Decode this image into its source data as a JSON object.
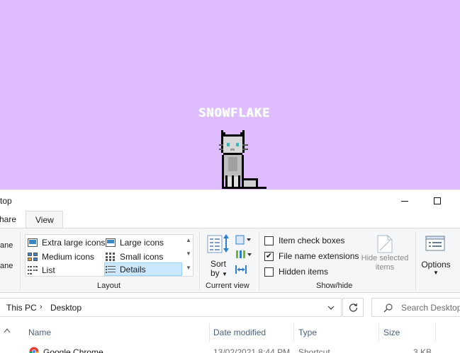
{
  "wallpaper": {
    "title": "SNOWFLAKE",
    "background": "#dfbcfd"
  },
  "window": {
    "title": "top",
    "minimize_icon": "minimize-icon",
    "maximize_icon": "maximize-icon"
  },
  "ribbon": {
    "tabs": [
      "hare",
      "View"
    ],
    "panes": {
      "items": [
        "ane",
        "ane"
      ]
    },
    "layout": {
      "items": [
        "Extra large icons",
        "Large icons",
        "Medium icons",
        "Small icons",
        "List",
        "Details"
      ],
      "selected": "Details",
      "group_label": "Layout"
    },
    "current_view": {
      "sort_label_1": "Sort",
      "sort_label_2": "by",
      "group_label": "Current view"
    },
    "show_hide": {
      "item_check_boxes": {
        "label": "Item check boxes",
        "checked": false
      },
      "file_name_extensions": {
        "label": "File name extensions",
        "checked": true
      },
      "hidden_items": {
        "label": "Hidden items",
        "checked": false
      },
      "hide_selected_1": "Hide selected",
      "hide_selected_2": "items",
      "group_label": "Show/hide"
    },
    "options": {
      "label": "Options"
    }
  },
  "address": {
    "crumbs": [
      "This PC",
      "Desktop"
    ],
    "search_placeholder": "Search Desktop"
  },
  "columns": [
    "Name",
    "Date modified",
    "Type",
    "Size"
  ],
  "files": [
    {
      "name": "Google Chrome",
      "date": "13/02/2021 8:44 PM",
      "type": "Shortcut",
      "size": "3 KB"
    }
  ]
}
